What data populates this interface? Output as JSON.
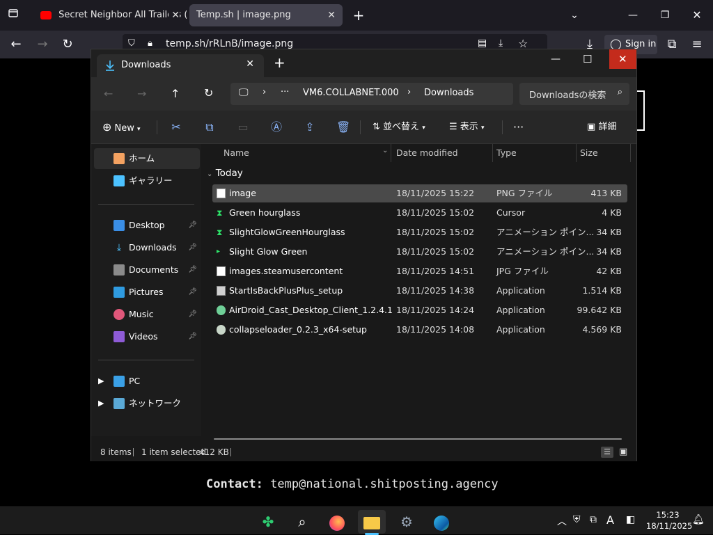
{
  "browser": {
    "tabs": [
      {
        "label": "Secret Neighbor All Trailers (Kin"
      },
      {
        "label": "Temp.sh | image.png"
      }
    ],
    "url": "temp.sh/rRLnB/image.png",
    "sign_in": "Sign in"
  },
  "page": {
    "contact_label": "Contact:",
    "contact_value": "temp@national.shitposting.agency"
  },
  "explorer": {
    "tab_title": "Downloads",
    "breadcrumb": {
      "ellipsis": "···",
      "root": "VM6.COLLABNET.000",
      "current": "Downloads"
    },
    "search_placeholder": "Downloadsの検索",
    "toolbar": {
      "new": "New",
      "sort": "並べ替え",
      "view": "表示",
      "details": "詳細",
      "more": "···"
    },
    "sidebar": {
      "top": [
        {
          "label": "ホーム"
        },
        {
          "label": "ギャラリー"
        }
      ],
      "pinned": [
        {
          "label": "Desktop"
        },
        {
          "label": "Downloads"
        },
        {
          "label": "Documents"
        },
        {
          "label": "Pictures"
        },
        {
          "label": "Music"
        },
        {
          "label": "Videos"
        }
      ],
      "bottom": [
        {
          "label": "PC"
        },
        {
          "label": "ネットワーク"
        }
      ]
    },
    "columns": {
      "name": "Name",
      "date": "Date modified",
      "type": "Type",
      "size": "Size"
    },
    "group": "Today",
    "files": [
      {
        "name": "image",
        "date": "18/11/2025 15:22",
        "type": "PNG ファイル",
        "size": "413 KB"
      },
      {
        "name": "Green hourglass",
        "date": "18/11/2025 15:02",
        "type": "Cursor",
        "size": "4 KB"
      },
      {
        "name": "SlightGlowGreenHourglass",
        "date": "18/11/2025 15:02",
        "type": "アニメーション ポイン...",
        "size": "34 KB"
      },
      {
        "name": "Slight Glow Green",
        "date": "18/11/2025 15:02",
        "type": "アニメーション ポイン...",
        "size": "34 KB"
      },
      {
        "name": "images.steamusercontent",
        "date": "18/11/2025 14:51",
        "type": "JPG ファイル",
        "size": "42 KB"
      },
      {
        "name": "StartIsBackPlusPlus_setup",
        "date": "18/11/2025 14:38",
        "type": "Application",
        "size": "1.514 KB"
      },
      {
        "name": "AirDroid_Cast_Desktop_Client_1.2.4.1",
        "date": "18/11/2025 14:24",
        "type": "Application",
        "size": "99.642 KB"
      },
      {
        "name": "collapseloader_0.2.3_x64-setup",
        "date": "18/11/2025 14:08",
        "type": "Application",
        "size": "4.569 KB"
      }
    ],
    "status": {
      "items": "8 items",
      "selected": "1 item selected",
      "size": "412 KB"
    }
  },
  "taskbar": {
    "time": "15:23",
    "date": "18/11/2025"
  },
  "colors": {
    "accent": "#0067c0",
    "selection": "#4a4a4a",
    "folder": "#f7c948"
  }
}
